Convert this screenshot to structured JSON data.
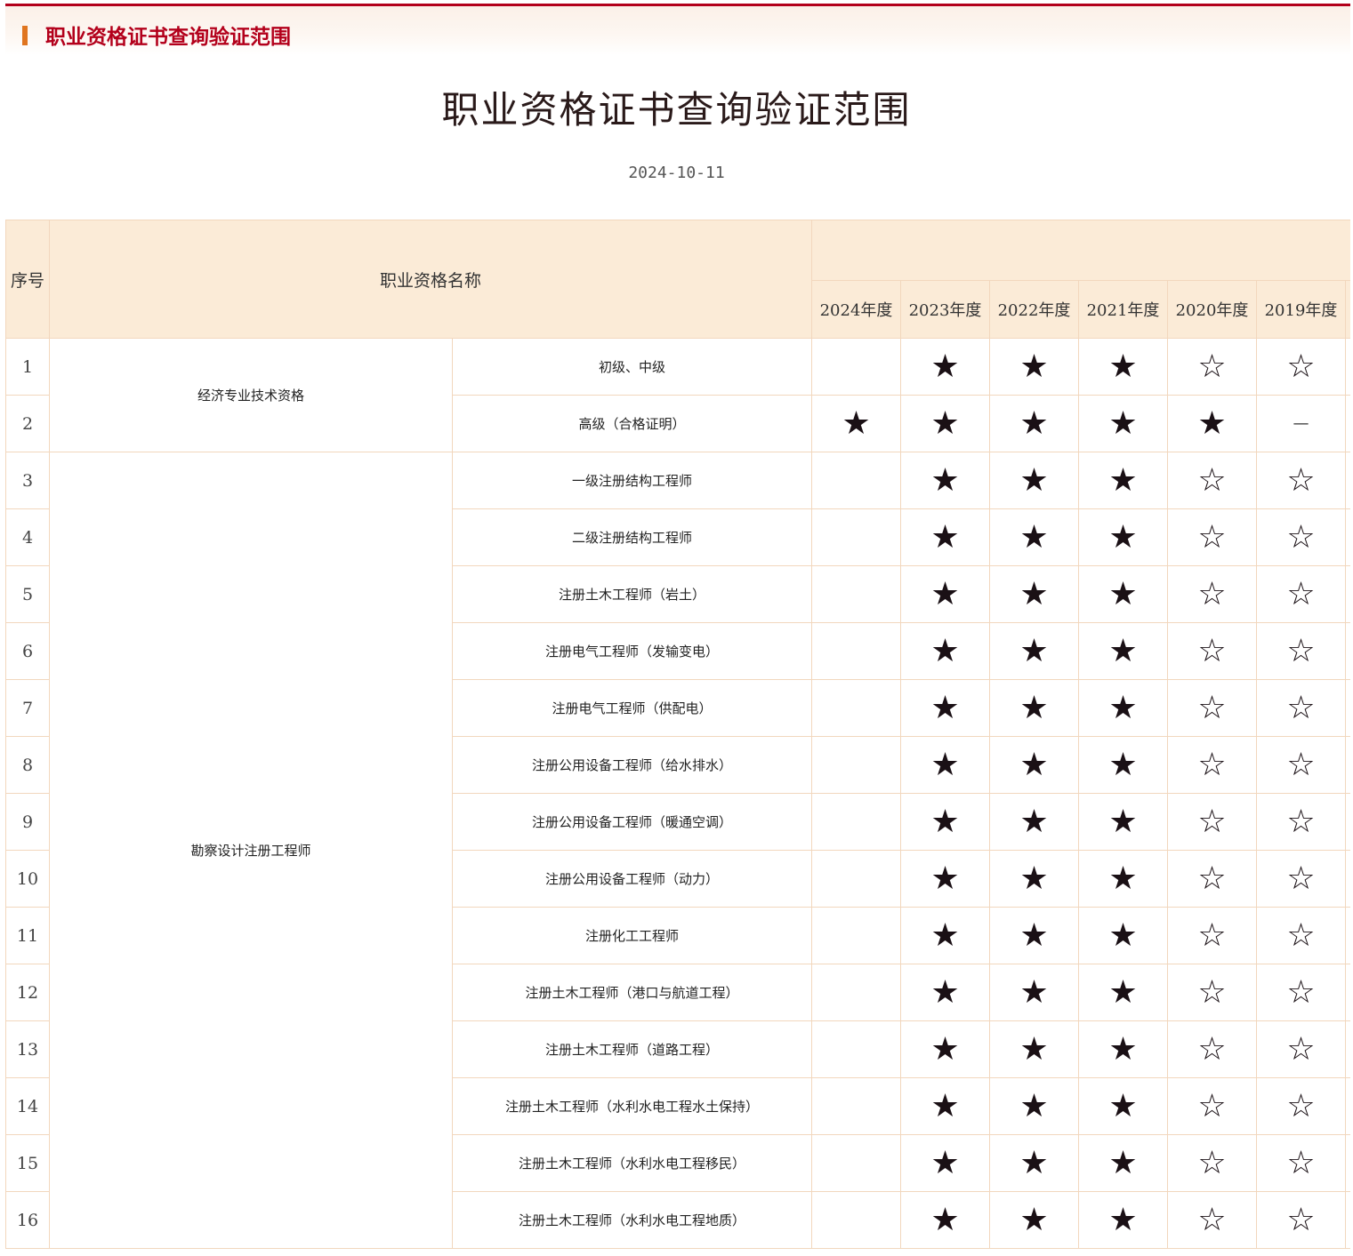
{
  "header": {
    "section_title": "职业资格证书查询验证范围"
  },
  "page": {
    "title": "职业资格证书查询验证范围",
    "date": "2024-10-11"
  },
  "table": {
    "headers": {
      "index": "序号",
      "name": "职业资格名称",
      "years": [
        "2024年度",
        "2023年度",
        "2022年度",
        "2021年度",
        "2020年度",
        "2019年度"
      ]
    },
    "symbols": {
      "full": "★",
      "empty": "☆",
      "none": "—",
      "blank": ""
    },
    "groups": [
      {
        "category": "经济专业技术资格",
        "rows": [
          {
            "index": "1",
            "name": "初级、中级",
            "marks": [
              "blank",
              "full",
              "full",
              "full",
              "empty",
              "empty"
            ]
          },
          {
            "index": "2",
            "name": "高级（合格证明）",
            "marks": [
              "full",
              "full",
              "full",
              "full",
              "full",
              "none"
            ]
          }
        ]
      },
      {
        "category": "勘察设计注册工程师",
        "rows": [
          {
            "index": "3",
            "name": "一级注册结构工程师",
            "marks": [
              "blank",
              "full",
              "full",
              "full",
              "empty",
              "empty"
            ]
          },
          {
            "index": "4",
            "name": "二级注册结构工程师",
            "marks": [
              "blank",
              "full",
              "full",
              "full",
              "empty",
              "empty"
            ]
          },
          {
            "index": "5",
            "name": "注册土木工程师（岩土）",
            "marks": [
              "blank",
              "full",
              "full",
              "full",
              "empty",
              "empty"
            ]
          },
          {
            "index": "6",
            "name": "注册电气工程师（发输变电）",
            "marks": [
              "blank",
              "full",
              "full",
              "full",
              "empty",
              "empty"
            ]
          },
          {
            "index": "7",
            "name": "注册电气工程师（供配电）",
            "marks": [
              "blank",
              "full",
              "full",
              "full",
              "empty",
              "empty"
            ]
          },
          {
            "index": "8",
            "name": "注册公用设备工程师（给水排水）",
            "marks": [
              "blank",
              "full",
              "full",
              "full",
              "empty",
              "empty"
            ]
          },
          {
            "index": "9",
            "name": "注册公用设备工程师（暖通空调）",
            "marks": [
              "blank",
              "full",
              "full",
              "full",
              "empty",
              "empty"
            ]
          },
          {
            "index": "10",
            "name": "注册公用设备工程师（动力）",
            "marks": [
              "blank",
              "full",
              "full",
              "full",
              "empty",
              "empty"
            ]
          },
          {
            "index": "11",
            "name": "注册化工工程师",
            "marks": [
              "blank",
              "full",
              "full",
              "full",
              "empty",
              "empty"
            ]
          },
          {
            "index": "12",
            "name": "注册土木工程师（港口与航道工程）",
            "marks": [
              "blank",
              "full",
              "full",
              "full",
              "empty",
              "empty"
            ]
          },
          {
            "index": "13",
            "name": "注册土木工程师（道路工程）",
            "marks": [
              "blank",
              "full",
              "full",
              "full",
              "empty",
              "empty"
            ]
          },
          {
            "index": "14",
            "name": "注册土木工程师（水利水电工程水土保持）",
            "marks": [
              "blank",
              "full",
              "full",
              "full",
              "empty",
              "empty"
            ]
          },
          {
            "index": "15",
            "name": "注册土木工程师（水利水电工程移民）",
            "marks": [
              "blank",
              "full",
              "full",
              "full",
              "empty",
              "empty"
            ]
          },
          {
            "index": "16",
            "name": "注册土木工程师（水利水电工程地质）",
            "marks": [
              "blank",
              "full",
              "full",
              "full",
              "empty",
              "empty"
            ]
          }
        ]
      }
    ]
  },
  "colors": {
    "accent": "#b3001b",
    "marker": "#e0751f",
    "header_bg": "#fbebd7",
    "border": "#f2d7bd"
  }
}
